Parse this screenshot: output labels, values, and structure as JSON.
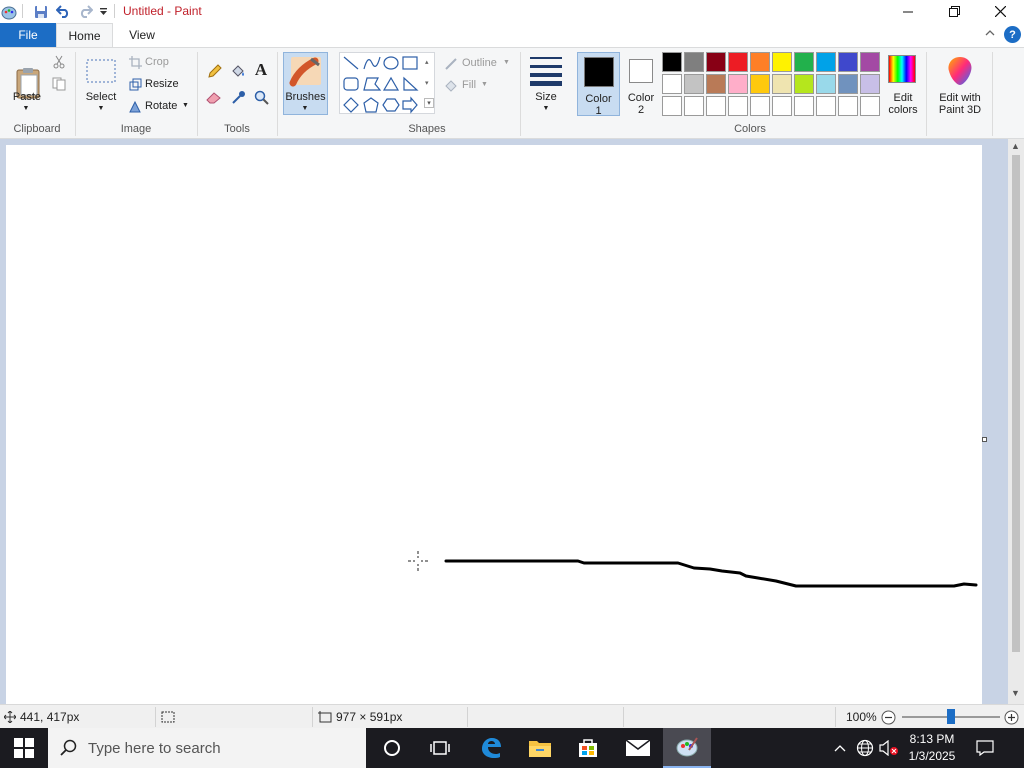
{
  "window": {
    "title": "Untitled - Paint",
    "minimize_icon": "minimize-icon",
    "maximize_icon": "maximize-icon",
    "close_icon": "close-icon"
  },
  "quick_access": {
    "icons": [
      "paint-app-icon",
      "save-icon",
      "undo-icon",
      "redo-icon",
      "customize-dropdown-icon"
    ]
  },
  "tabs": [
    {
      "label": "File"
    },
    {
      "label": "Home"
    },
    {
      "label": "View"
    }
  ],
  "help_label": "?",
  "ribbon": {
    "clipboard": {
      "group_label": "Clipboard",
      "paste_label": "Paste",
      "cut_icon": "scissors-icon",
      "copy_icon": "copy-icon"
    },
    "image": {
      "group_label": "Image",
      "select_label": "Select",
      "crop_label": "Crop",
      "resize_label": "Resize",
      "rotate_label": "Rotate"
    },
    "tools": {
      "group_label": "Tools",
      "items": [
        "pencil-icon",
        "fill-bucket-icon",
        "text-icon",
        "eraser-icon",
        "color-picker-icon",
        "magnifier-icon"
      ],
      "text_glyph": "A"
    },
    "brushes": {
      "label": "Brushes"
    },
    "shapes": {
      "group_label": "Shapes",
      "outline_label": "Outline",
      "fill_label": "Fill",
      "items": [
        "line-shape-icon",
        "curve-shape-icon",
        "oval-shape-icon",
        "rectangle-shape-icon",
        "rounded-rectangle-shape-icon",
        "polygon-shape-icon",
        "triangle-shape-icon",
        "right-triangle-shape-icon",
        "diamond-shape-icon",
        "pentagon-shape-icon",
        "hexagon-shape-icon",
        "right-arrow-shape-icon"
      ]
    },
    "size": {
      "label": "Size"
    },
    "color1": {
      "label_line1": "Color",
      "label_line2": "1",
      "color": "#000000"
    },
    "color2": {
      "label_line1": "Color",
      "label_line2": "2",
      "color": "#ffffff"
    },
    "colors": {
      "group_label": "Colors",
      "palette_row1": [
        "#000000",
        "#7f7f7f",
        "#880015",
        "#ed1c24",
        "#ff7f27",
        "#fff200",
        "#22b14c",
        "#00a2e8",
        "#3f48cc",
        "#a349a4"
      ],
      "palette_row2": [
        "#ffffff",
        "#c3c3c3",
        "#b97a57",
        "#ffaec9",
        "#ffc90e",
        "#efe4b0",
        "#b5e61d",
        "#99d9ea",
        "#7092be",
        "#c8bfe7"
      ],
      "palette_row3": [
        "#ffffff",
        "#ffffff",
        "#ffffff",
        "#ffffff",
        "#ffffff",
        "#ffffff",
        "#ffffff",
        "#ffffff",
        "#ffffff",
        "#ffffff"
      ],
      "edit_colors_line1": "Edit",
      "edit_colors_line2": "colors"
    },
    "paint3d": {
      "line1": "Edit with",
      "line2": "Paint 3D"
    }
  },
  "status": {
    "cursor_pos": "441, 417px",
    "selection_size": "",
    "canvas_size": "977 × 591px",
    "zoom": "100%",
    "zoom_level": 0.5
  },
  "taskbar": {
    "search_placeholder": "Type here to search",
    "time": "8:13 PM",
    "date": "1/3/2025",
    "icons": [
      "windows-start-icon",
      "search-icon",
      "cortana-icon",
      "task-view-icon",
      "edge-icon",
      "file-explorer-icon",
      "store-icon",
      "mail-icon",
      "paint-taskbar-icon",
      "show-hidden-icons-icon",
      "network-icon",
      "volume-muted-icon",
      "notifications-icon"
    ]
  }
}
